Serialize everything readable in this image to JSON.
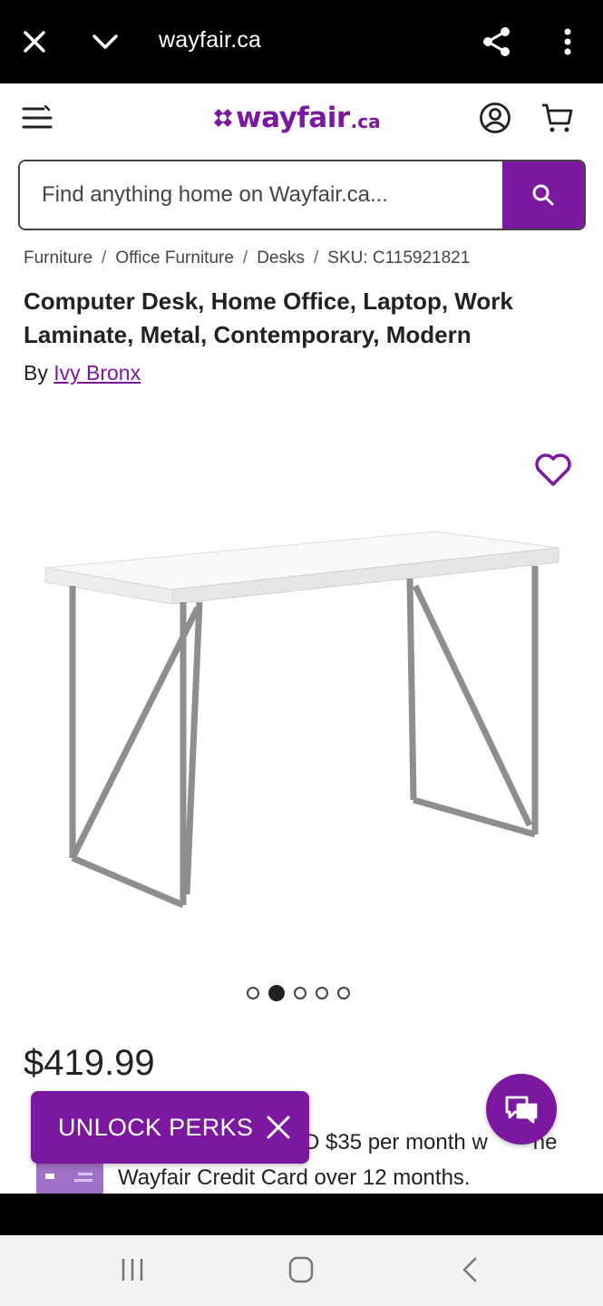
{
  "browser": {
    "url": "wayfair.ca"
  },
  "header": {
    "logo_text": "wayfair",
    "logo_tld": ".ca"
  },
  "search": {
    "placeholder": "Find anything home on Wayfair.ca..."
  },
  "breadcrumb": [
    "Furniture",
    "Office Furniture",
    "Desks",
    "SKU: C115921821"
  ],
  "breadcrumb_separator": "/",
  "product": {
    "title": "Computer Desk, Home Office, Laptop, Work Laminate, Metal, Contemporary, Modern",
    "by_label": "By",
    "brand": "Ivy Bronx",
    "price": "$419.99",
    "financing_prefix": "D $35 per month w",
    "financing_suffix": "ne",
    "financing_line2": "Wayfair Credit Card over 12 months."
  },
  "carousel": {
    "active_index": 1,
    "count": 5
  },
  "perks": {
    "label": "UNLOCK PERKS"
  },
  "colors": {
    "brand": "#7b189f"
  }
}
